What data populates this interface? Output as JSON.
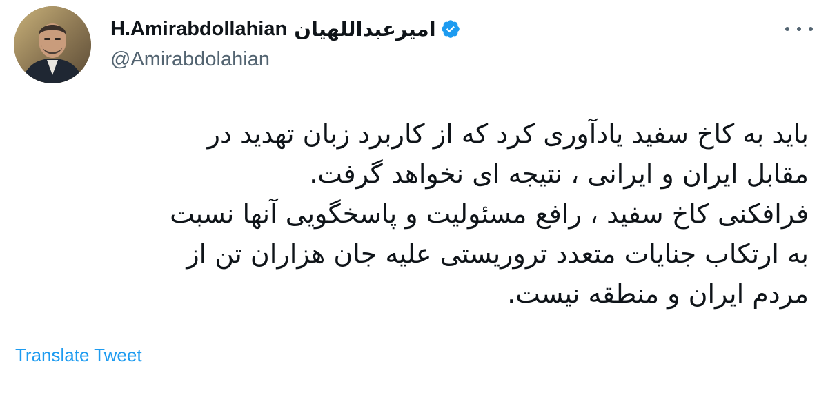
{
  "author": {
    "display_name": "H.Amirabdollahian",
    "native_name": "امیرعبداللهیان",
    "handle": "@Amirabdolahian",
    "verified_color": "#1d9bf0",
    "avatar_icon": "profile-photo"
  },
  "tweet": {
    "lines": [
      "باید به کاخ سفید یادآوری کرد که از کاربرد زبان تهدید در",
      "مقابل ایران و ایرانی ، نتیجه ای نخواهد گرفت.",
      "فرافکنی کاخ سفید ، رافع مسئولیت و پاسخگویی آنها نسبت",
      "به ارتکاب جنایات متعدد تروریستی علیه جان هزاران تن از",
      "مردم ایران و منطقه نیست."
    ]
  },
  "actions": {
    "translate_label": "Translate Tweet",
    "more_icon": "more-horizontal-icon"
  },
  "colors": {
    "link": "#1d9bf0",
    "secondary_text": "#536471",
    "primary_text": "#0f1419"
  }
}
